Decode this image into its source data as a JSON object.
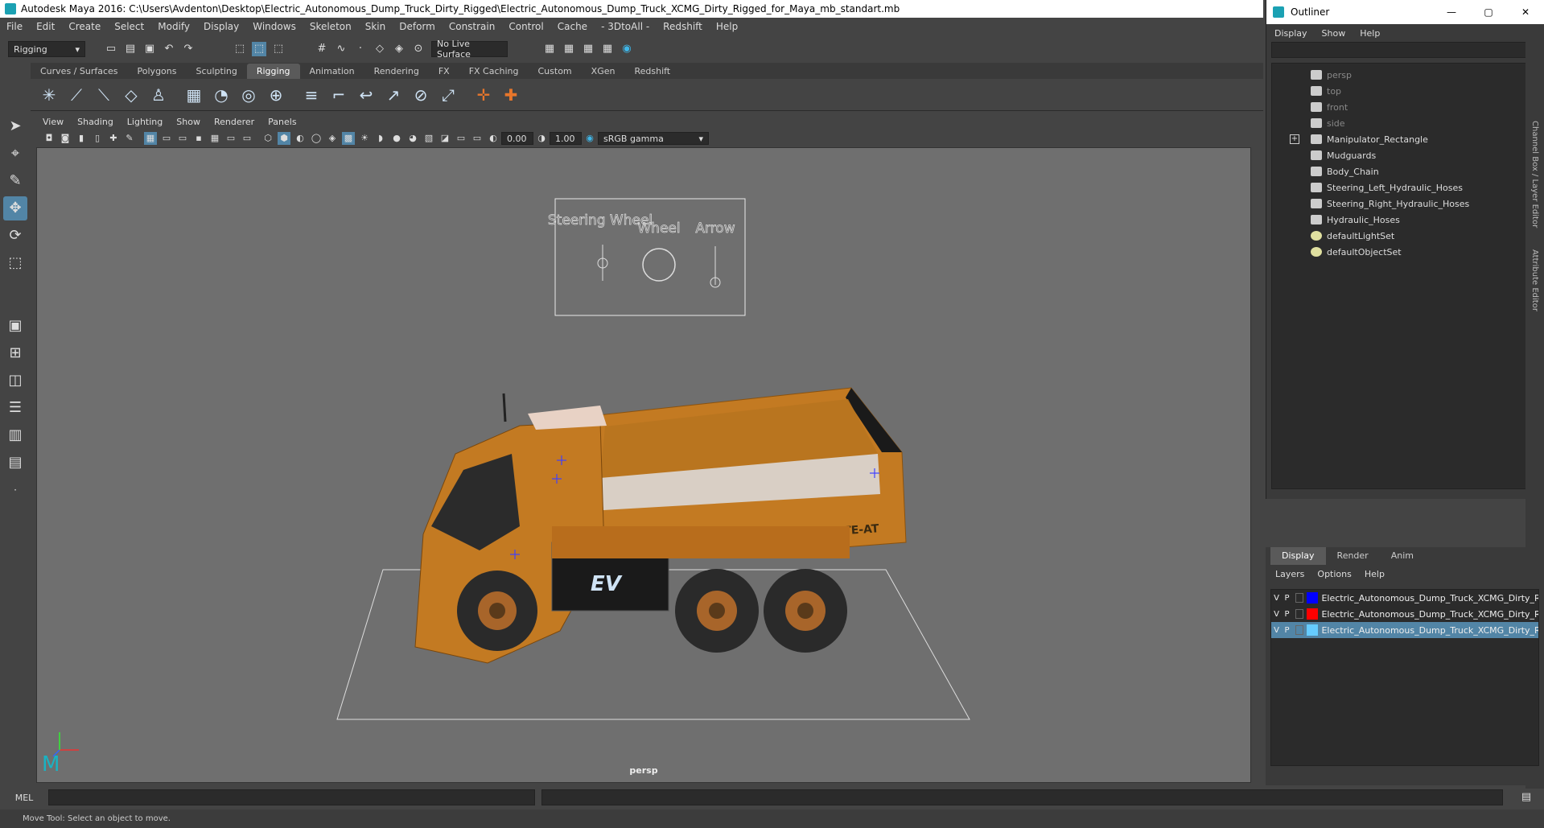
{
  "window": {
    "title": "Autodesk Maya 2016: C:\\Users\\Avdenton\\Desktop\\Electric_Autonomous_Dump_Truck_Dirty_Rigged\\Electric_Autonomous_Dump_Truck_XCMG_Dirty_Rigged_for_Maya_mb_standart.mb"
  },
  "menu": [
    "File",
    "Edit",
    "Create",
    "Select",
    "Modify",
    "Display",
    "Windows",
    "Skeleton",
    "Skin",
    "Deform",
    "Constrain",
    "Control",
    "Cache",
    "- 3DtoAll -",
    "Redshift",
    "Help"
  ],
  "status": {
    "mode": "Rigging",
    "live_surface": "No Live Surface"
  },
  "shelf_tabs": [
    "Curves / Surfaces",
    "Polygons",
    "Sculpting",
    "Rigging",
    "Animation",
    "Rendering",
    "FX",
    "FX Caching",
    "Custom",
    "XGen",
    "Redshift"
  ],
  "shelf_active": "Rigging",
  "viewport": {
    "menu": [
      "View",
      "Shading",
      "Lighting",
      "Show",
      "Renderer",
      "Panels"
    ],
    "field_a": "0.00",
    "field_b": "1.00",
    "color_space": "sRGB gamma",
    "camera_label": "persp",
    "manipulator_labels": [
      "Steering Wheel",
      "Wheel",
      "Arrow"
    ],
    "truck_text": "XDR80TE-AT",
    "ev_badge": "EV"
  },
  "cmd": {
    "label": "MEL"
  },
  "help_line": "Move Tool: Select an object to move.",
  "outliner": {
    "title": "Outliner",
    "menu": [
      "Display",
      "Show",
      "Help"
    ],
    "items": [
      {
        "label": "persp",
        "dim": true,
        "icon": "camera-icon"
      },
      {
        "label": "top",
        "dim": true,
        "icon": "camera-icon"
      },
      {
        "label": "front",
        "dim": true,
        "icon": "camera-icon"
      },
      {
        "label": "side",
        "dim": true,
        "icon": "camera-icon"
      },
      {
        "label": "Manipulator_Rectangle",
        "dim": false,
        "icon": "group-icon",
        "expand": true
      },
      {
        "label": "Mudguards",
        "dim": false,
        "icon": "group-icon"
      },
      {
        "label": "Body_Chain",
        "dim": false,
        "icon": "group-icon"
      },
      {
        "label": "Steering_Left_Hydraulic_Hoses",
        "dim": false,
        "icon": "group-icon"
      },
      {
        "label": "Steering_Right_Hydraulic_Hoses",
        "dim": false,
        "icon": "group-icon"
      },
      {
        "label": "Hydraulic_Hoses",
        "dim": false,
        "icon": "group-icon"
      },
      {
        "label": "defaultLightSet",
        "dim": false,
        "icon": "set-icon"
      },
      {
        "label": "defaultObjectSet",
        "dim": false,
        "icon": "set-icon"
      }
    ]
  },
  "side_tabs": [
    "Channel Box / Layer Editor",
    "Attribute Editor"
  ],
  "layers": {
    "tabs": [
      "Display",
      "Render",
      "Anim"
    ],
    "menu": [
      "Layers",
      "Options",
      "Help"
    ],
    "rows": [
      {
        "v": "V",
        "p": "P",
        "color": "#0000ff",
        "label": "Electric_Autonomous_Dump_Truck_XCMG_Dirty_Rigg",
        "selected": false
      },
      {
        "v": "V",
        "p": "P",
        "color": "#ff0000",
        "label": "Electric_Autonomous_Dump_Truck_XCMG_Dirty_Rigg",
        "selected": false
      },
      {
        "v": "V",
        "p": "P",
        "color": "#66ccff",
        "label": "Electric_Autonomous_Dump_Truck_XCMG_Dirty_Rigg",
        "selected": true
      }
    ]
  }
}
